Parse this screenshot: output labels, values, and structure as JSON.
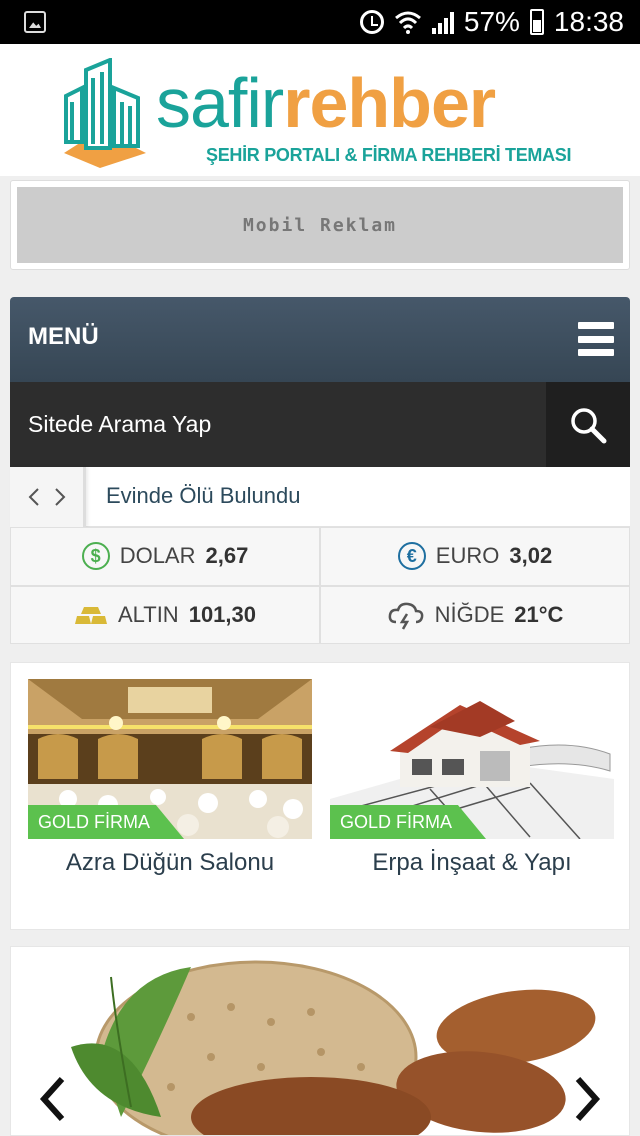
{
  "status_bar": {
    "battery": "57%",
    "time": "18:38"
  },
  "logo": {
    "name_part1": "safir",
    "name_part2": "rehber",
    "tagline": "ŞEHİR PORTALI & FİRMA REHBERİ TEMASI",
    "colors": {
      "teal": "#1aa39a",
      "orange": "#f0a043"
    }
  },
  "ad": {
    "label": "Mobil Reklam"
  },
  "menu": {
    "label": "MENÜ"
  },
  "search": {
    "placeholder": "Sitede Arama Yap"
  },
  "ticker": {
    "headline": "Evinde Ölü Bulundu"
  },
  "info": {
    "dollar": {
      "label": "DOLAR",
      "value": "2,67"
    },
    "euro": {
      "label": "EURO",
      "value": "3,02"
    },
    "gold": {
      "label": "ALTIN",
      "value": "101,30"
    },
    "weather": {
      "label": "NİĞDE",
      "value": "21°C"
    }
  },
  "firms": [
    {
      "badge": "GOLD FİRMA",
      "name": "Azra Düğün Salonu"
    },
    {
      "badge": "GOLD FİRMA",
      "name": "Erpa İnşaat & Yapı"
    }
  ]
}
